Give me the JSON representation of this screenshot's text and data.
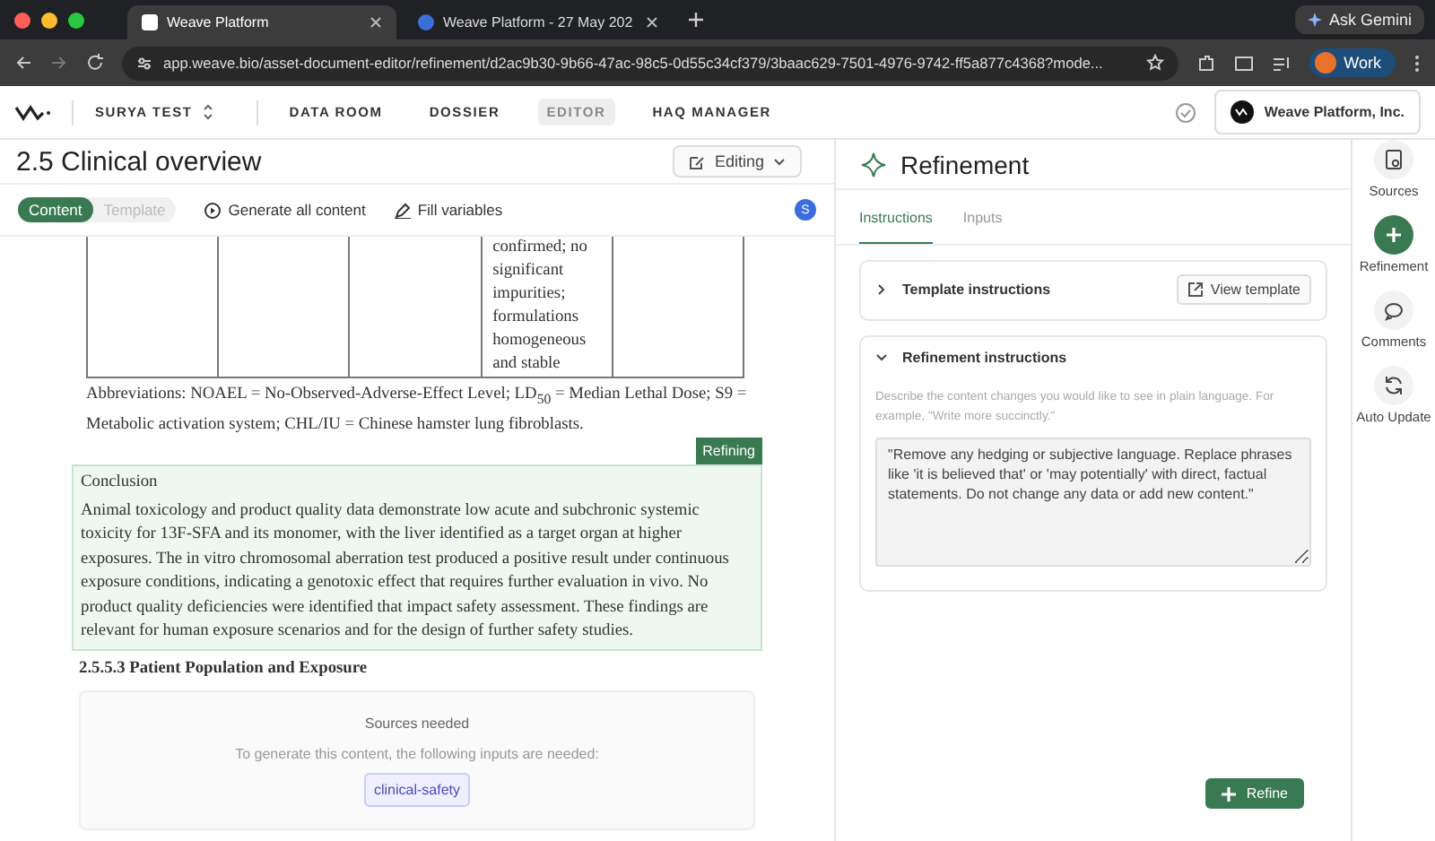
{
  "browser": {
    "tabs": [
      {
        "title": "Weave Platform",
        "selected": true
      },
      {
        "title": "Weave Platform - 27 May 202",
        "selected": false
      }
    ],
    "ask": "Ask Gemini",
    "url": "app.weave.bio/asset-document-editor/refinement/d2ac9b30-9b66-47ac-98c5-0d55c34cf379/3baac629-7501-4976-9742-ff5a877c4368?mode...",
    "profile": "Work"
  },
  "header": {
    "workspace": "SURYA TEST",
    "nav": [
      {
        "label": "DATA ROOM",
        "selected": false
      },
      {
        "label": "DOSSIER",
        "selected": false
      },
      {
        "label": "EDITOR",
        "selected": true
      },
      {
        "label": "HAQ MANAGER",
        "selected": false
      }
    ],
    "org": "Weave Platform, Inc."
  },
  "document": {
    "title": "2.5 Clinical overview",
    "mode": "Editing",
    "view_toggle": [
      {
        "label": "Content",
        "selected": true
      },
      {
        "label": "Template",
        "selected": false
      }
    ],
    "actions": [
      {
        "label": "Generate all content",
        "kind": "play"
      },
      {
        "label": "Fill variables",
        "kind": "pen"
      }
    ],
    "avatar": "S",
    "table_fragment": {
      "cells": [
        "",
        "",
        "",
        "confirmed; no significant impurities; formulations homogeneous and stable",
        ""
      ]
    },
    "abbreviations": "Abbreviations: NOAEL = No-Observed-Adverse-Effect Level; LD$_{50}$ = Median Lethal Dose; S9 = Metabolic activation system; CHL/IU = Chinese hamster lung fibroblasts.",
    "refining_badge": "Refining",
    "conclusion": {
      "heading": "Conclusion",
      "text": "Animal toxicology and product quality data demonstrate low acute and subchronic systemic toxicity for 13F-SFA and its monomer, with the liver identified as a target organ at higher exposures. The in vitro chromosomal aberration test produced a positive result under continuous exposure conditions, indicating a genotoxic effect that requires further evaluation in vivo. No product quality deficiencies were identified that impact safety assessment. These findings are relevant for human exposure scenarios and for the design of further safety studies."
    },
    "section_heading": "2.5.5.3 Patient Population and Exposure",
    "sources_needed": {
      "title": "Sources needed",
      "text": "To generate this content, the following inputs are needed:",
      "tags": [
        "clinical-safety"
      ]
    }
  },
  "refinement": {
    "title": "Refinement",
    "tabs": [
      {
        "label": "Instructions",
        "selected": true
      },
      {
        "label": "Inputs",
        "selected": false
      }
    ],
    "sections": [
      {
        "title": "Template instructions",
        "expanded": false,
        "button": "View template"
      },
      {
        "title": "Refinement instructions",
        "expanded": true,
        "description": "Describe the content changes you would like to see in plain language. For example, \"Write more succinctly.\"",
        "value": "\"Remove any hedging or subjective language. Replace phrases like 'it is believed that' or 'may potentially' with direct, factual statements. Do not change any data or add new content.\""
      }
    ],
    "refine_button": "Refine"
  },
  "rail": [
    {
      "label": "Sources",
      "kind": "sources",
      "selected": false
    },
    {
      "label": "Refinement",
      "kind": "plus",
      "selected": true
    },
    {
      "label": "Comments",
      "kind": "comments",
      "selected": false
    },
    {
      "label": "Auto Update",
      "kind": "sync",
      "selected": false
    }
  ]
}
